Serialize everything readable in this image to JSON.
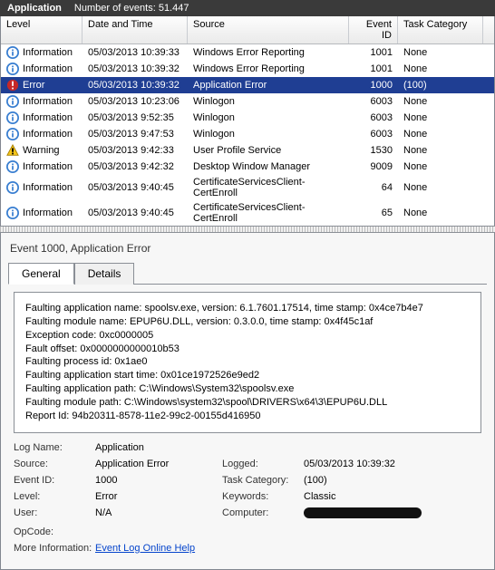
{
  "titlebar": {
    "app": "Application",
    "events_label": "Number of events: 51.447"
  },
  "columns": {
    "level": "Level",
    "date": "Date and Time",
    "source": "Source",
    "id": "Event ID",
    "cat": "Task Category"
  },
  "rows": [
    {
      "icon": "info",
      "level": "Information",
      "date": "05/03/2013 10:39:33",
      "source": "Windows Error Reporting",
      "id": "1001",
      "cat": "None",
      "sel": false
    },
    {
      "icon": "info",
      "level": "Information",
      "date": "05/03/2013 10:39:32",
      "source": "Windows Error Reporting",
      "id": "1001",
      "cat": "None",
      "sel": false
    },
    {
      "icon": "error",
      "level": "Error",
      "date": "05/03/2013 10:39:32",
      "source": "Application Error",
      "id": "1000",
      "cat": "(100)",
      "sel": true
    },
    {
      "icon": "info",
      "level": "Information",
      "date": "05/03/2013 10:23:06",
      "source": "Winlogon",
      "id": "6003",
      "cat": "None",
      "sel": false
    },
    {
      "icon": "info",
      "level": "Information",
      "date": "05/03/2013 9:52:35",
      "source": "Winlogon",
      "id": "6003",
      "cat": "None",
      "sel": false
    },
    {
      "icon": "info",
      "level": "Information",
      "date": "05/03/2013 9:47:53",
      "source": "Winlogon",
      "id": "6003",
      "cat": "None",
      "sel": false
    },
    {
      "icon": "warn",
      "level": "Warning",
      "date": "05/03/2013 9:42:33",
      "source": "User Profile Service",
      "id": "1530",
      "cat": "None",
      "sel": false
    },
    {
      "icon": "info",
      "level": "Information",
      "date": "05/03/2013 9:42:32",
      "source": "Desktop Window Manager",
      "id": "9009",
      "cat": "None",
      "sel": false
    },
    {
      "icon": "info",
      "level": "Information",
      "date": "05/03/2013 9:40:45",
      "source": "CertificateServicesClient-CertEnroll",
      "id": "64",
      "cat": "None",
      "sel": false
    },
    {
      "icon": "info",
      "level": "Information",
      "date": "05/03/2013 9:40:45",
      "source": "CertificateServicesClient-CertEnroll",
      "id": "65",
      "cat": "None",
      "sel": false
    }
  ],
  "detail": {
    "title": "Event 1000, Application Error",
    "tabs": {
      "general": "General",
      "details": "Details"
    },
    "message": [
      "Faulting application name: spoolsv.exe, version: 6.1.7601.17514, time stamp: 0x4ce7b4e7",
      "Faulting module name: EPUP6U.DLL, version: 0.3.0.0, time stamp: 0x4f45c1af",
      "Exception code: 0xc0000005",
      "Fault offset: 0x0000000000010b53",
      "Faulting process id: 0x1ae0",
      "Faulting application start time: 0x01ce1972526e9ed2",
      "Faulting application path: C:\\Windows\\System32\\spoolsv.exe",
      "Faulting module path: C:\\Windows\\system32\\spool\\DRIVERS\\x64\\3\\EPUP6U.DLL",
      "Report Id: 94b20311-8578-11e2-99c2-00155d416950"
    ],
    "props": {
      "logname_l": "Log Name:",
      "logname_v": "Application",
      "source_l": "Source:",
      "source_v": "Application Error",
      "logged_l": "Logged:",
      "logged_v": "05/03/2013 10:39:32",
      "eventid_l": "Event ID:",
      "eventid_v": "1000",
      "taskcat_l": "Task Category:",
      "taskcat_v": "(100)",
      "level_l": "Level:",
      "level_v": "Error",
      "keywords_l": "Keywords:",
      "keywords_v": "Classic",
      "user_l": "User:",
      "user_v": "N/A",
      "computer_l": "Computer:",
      "opcode_l": "OpCode:",
      "moreinfo_l": "More Information:",
      "moreinfo_v": "Event Log Online Help"
    }
  }
}
